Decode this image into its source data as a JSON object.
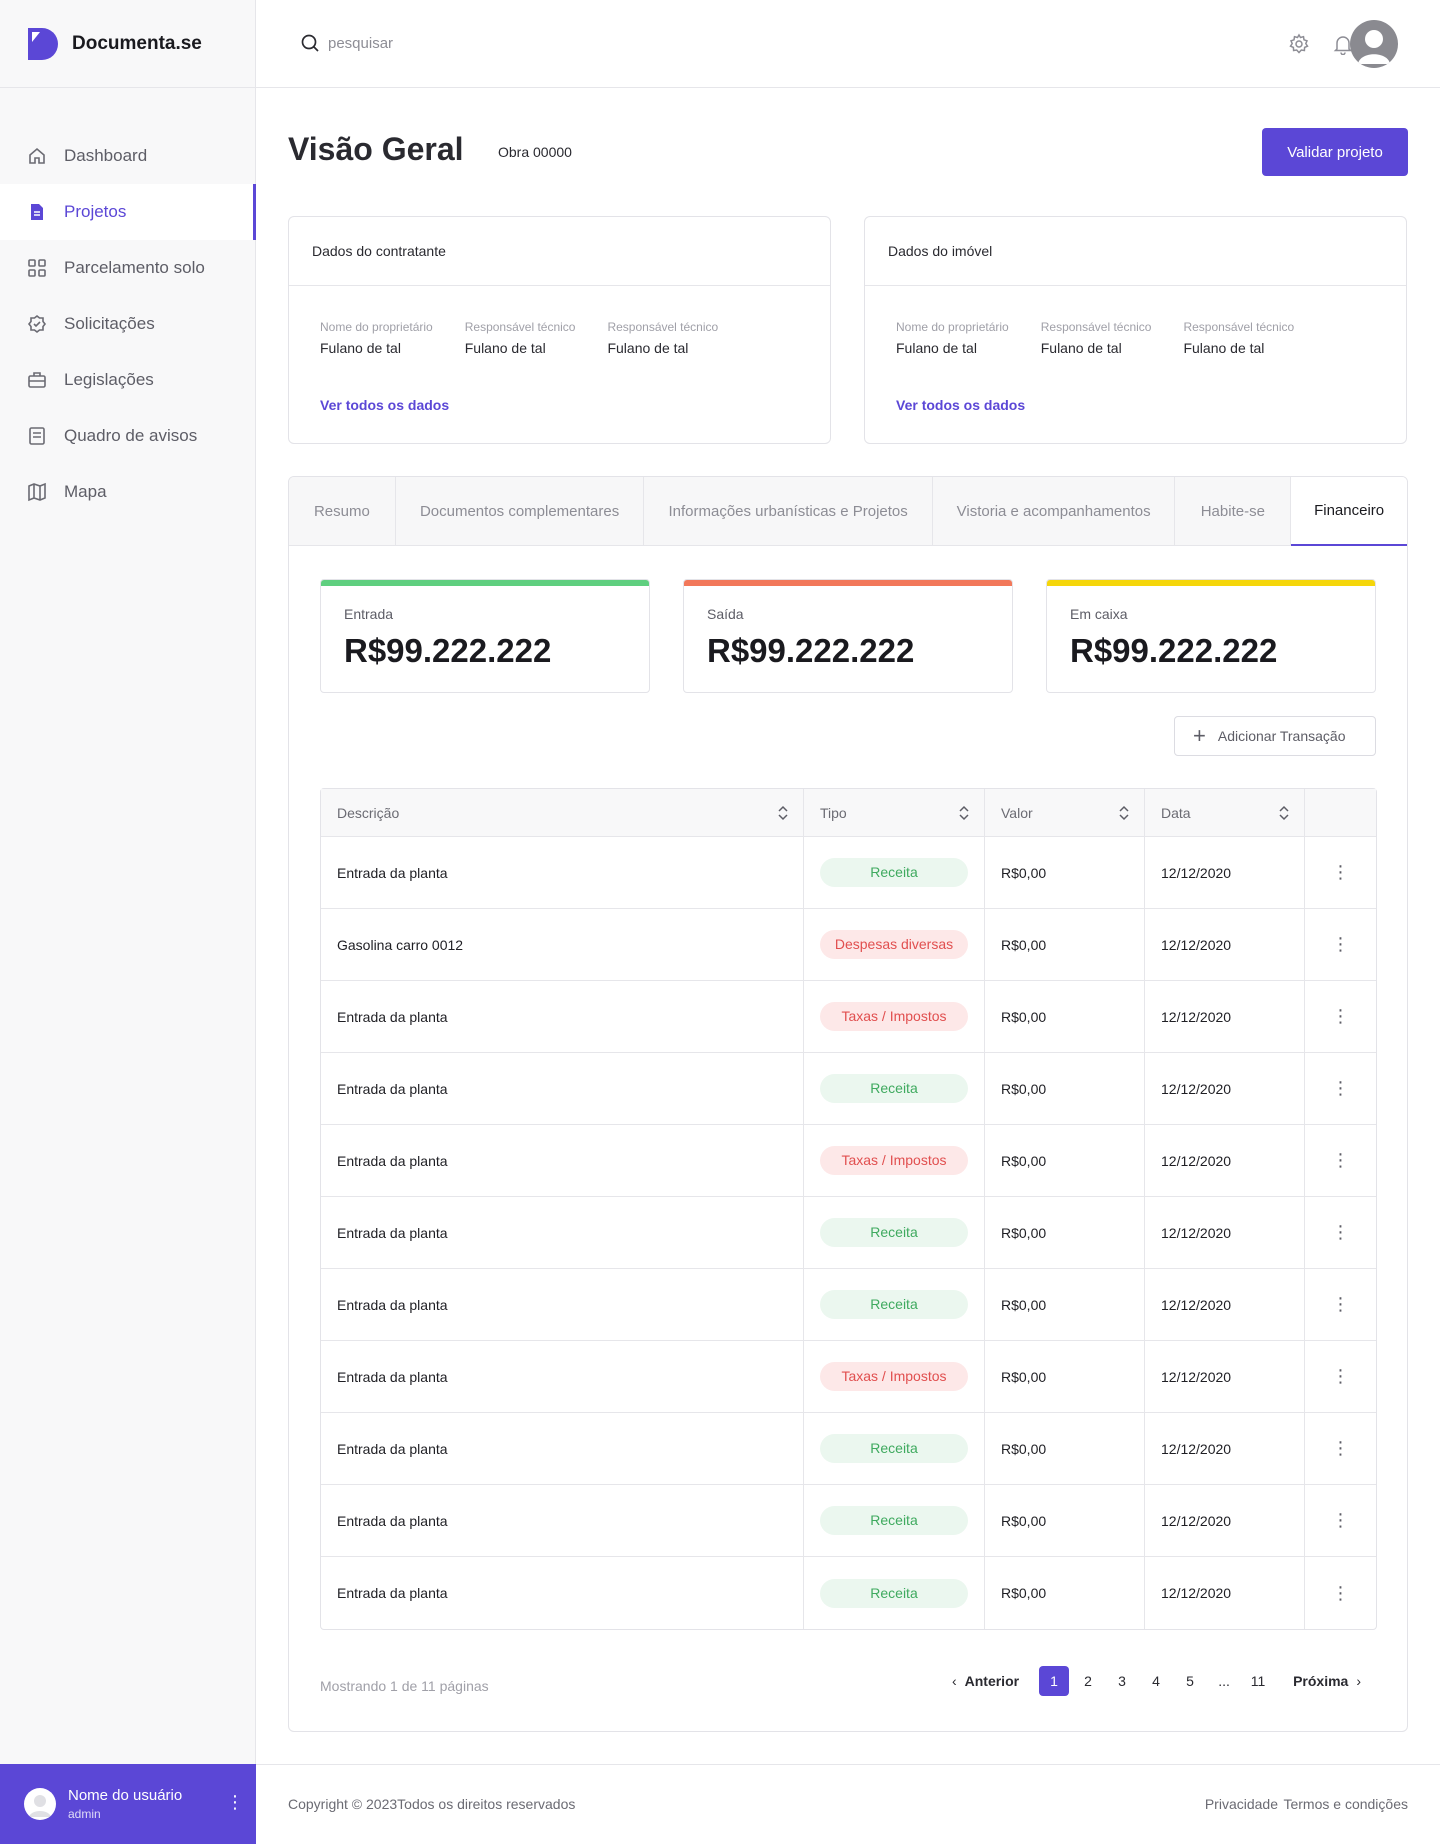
{
  "brand": {
    "name": "Documenta.se"
  },
  "sidebar": {
    "items": [
      {
        "label": "Dashboard",
        "icon": "home-icon",
        "active": false
      },
      {
        "label": "Projetos",
        "icon": "document-icon",
        "active": true
      },
      {
        "label": "Parcelamento solo",
        "icon": "grid-icon",
        "active": false
      },
      {
        "label": "Solicitações",
        "icon": "badge-check-icon",
        "active": false
      },
      {
        "label": "Legislações",
        "icon": "briefcase-icon",
        "active": false
      },
      {
        "label": "Quadro de avisos",
        "icon": "board-icon",
        "active": false
      },
      {
        "label": "Mapa",
        "icon": "map-icon",
        "active": false
      }
    ],
    "user": {
      "name": "Nome do usuário",
      "role": "admin"
    }
  },
  "header": {
    "search_placeholder": "pesquisar"
  },
  "page": {
    "title": "Visão Geral",
    "subtitle": "Obra 00000",
    "validate_label": "Validar projeto"
  },
  "cards": [
    {
      "title": "Dados do contratante",
      "fields": [
        {
          "label": "Nome do proprietário",
          "value": "Fulano de tal"
        },
        {
          "label": "Responsável técnico",
          "value": "Fulano de tal"
        },
        {
          "label": "Responsável técnico",
          "value": "Fulano de tal"
        }
      ],
      "link": "Ver todos os dados"
    },
    {
      "title": "Dados do imóvel",
      "fields": [
        {
          "label": "Nome do proprietário",
          "value": "Fulano de tal"
        },
        {
          "label": "Responsável técnico",
          "value": "Fulano de tal"
        },
        {
          "label": "Responsável técnico",
          "value": "Fulano de tal"
        }
      ],
      "link": "Ver todos os dados"
    }
  ],
  "tabs": [
    {
      "label": "Resumo",
      "active": false
    },
    {
      "label": "Documentos complementares",
      "active": false
    },
    {
      "label": "Informações urbanísticas e Projetos",
      "active": false
    },
    {
      "label": "Vistoria e acompanhamentos",
      "active": false
    },
    {
      "label": "Habite-se",
      "active": false
    },
    {
      "label": "Financeiro",
      "active": true
    }
  ],
  "kpis": [
    {
      "label": "Entrada",
      "value": "R$99.222.222",
      "color": "#5fcf7f"
    },
    {
      "label": "Saída",
      "value": "R$99.222.222",
      "color": "#f2785a"
    },
    {
      "label": "Em caixa",
      "value": "R$99.222.222",
      "color": "#f5d60a"
    }
  ],
  "add_transaction_label": "Adicionar Transação",
  "table": {
    "headers": [
      "Descrição",
      "Tipo",
      "Valor",
      "Data"
    ],
    "rows": [
      {
        "desc": "Entrada da planta",
        "tipo": "Receita",
        "kind": "receita",
        "valor": "R$0,00",
        "data": "12/12/2020"
      },
      {
        "desc": "Gasolina carro 0012",
        "tipo": "Despesas diversas",
        "kind": "despesa",
        "valor": "R$0,00",
        "data": "12/12/2020"
      },
      {
        "desc": "Entrada da planta",
        "tipo": "Taxas / Impostos",
        "kind": "despesa",
        "valor": "R$0,00",
        "data": "12/12/2020"
      },
      {
        "desc": "Entrada da planta",
        "tipo": "Receita",
        "kind": "receita",
        "valor": "R$0,00",
        "data": "12/12/2020"
      },
      {
        "desc": "Entrada da planta",
        "tipo": "Taxas / Impostos",
        "kind": "despesa",
        "valor": "R$0,00",
        "data": "12/12/2020"
      },
      {
        "desc": "Entrada da planta",
        "tipo": "Receita",
        "kind": "receita",
        "valor": "R$0,00",
        "data": "12/12/2020"
      },
      {
        "desc": "Entrada da planta",
        "tipo": "Receita",
        "kind": "receita",
        "valor": "R$0,00",
        "data": "12/12/2020"
      },
      {
        "desc": "Entrada da planta",
        "tipo": "Taxas / Impostos",
        "kind": "despesa",
        "valor": "R$0,00",
        "data": "12/12/2020"
      },
      {
        "desc": "Entrada da planta",
        "tipo": "Receita",
        "kind": "receita",
        "valor": "R$0,00",
        "data": "12/12/2020"
      },
      {
        "desc": "Entrada da planta",
        "tipo": "Receita",
        "kind": "receita",
        "valor": "R$0,00",
        "data": "12/12/2020"
      },
      {
        "desc": "Entrada da planta",
        "tipo": "Receita",
        "kind": "receita",
        "valor": "R$0,00",
        "data": "12/12/2020"
      }
    ]
  },
  "pagination": {
    "info": "Mostrando 1 de 11 páginas",
    "prev": "Anterior",
    "next": "Próxima",
    "pages": [
      "1",
      "2",
      "3",
      "4",
      "5",
      "...",
      "11"
    ],
    "current": "1"
  },
  "footer": {
    "copyright": "Copyright © 2023Todos os direitos reservados",
    "privacy": "Privacidade",
    "terms": "Termos e condições"
  },
  "colors": {
    "accent": "#5b47d6"
  }
}
